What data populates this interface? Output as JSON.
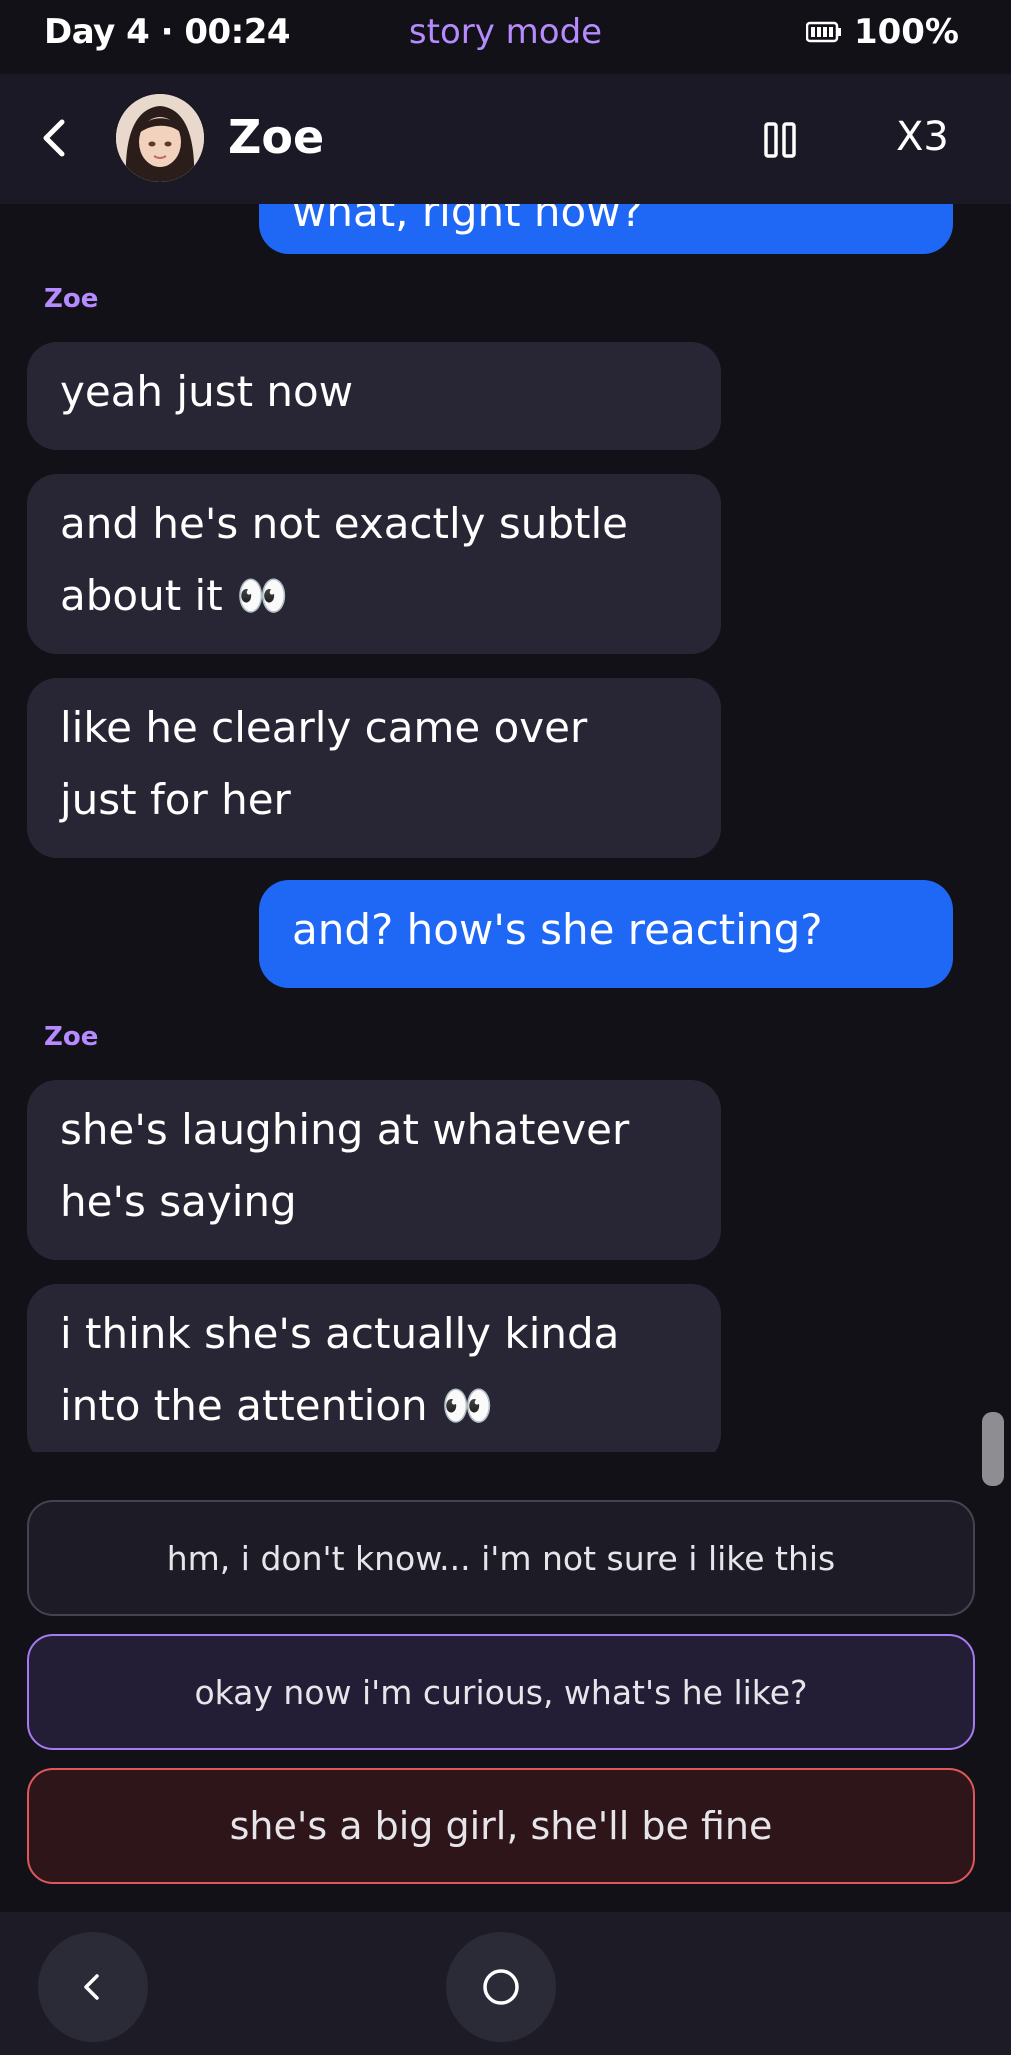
{
  "status": {
    "time_label": "Day 4 · 00:24",
    "mode": "story mode",
    "battery": "100%"
  },
  "header": {
    "contact_name": "Zoe",
    "speed": "X3"
  },
  "messages": {
    "top_partial": "what, right now?",
    "sender_1": "Zoe",
    "m1": "yeah just now",
    "m2_line1": "and he's not exactly subtle",
    "m2_line2": "about it 👀",
    "m3_line1": "like he clearly came over",
    "m3_line2": "just for her",
    "out1": "and? how's she reacting?",
    "sender_2": "Zoe",
    "m4_line1": "she's laughing at whatever",
    "m4_line2": "he's saying",
    "m5_line1": "i think she's actually kinda",
    "m5_line2": "into the attention 👀"
  },
  "choices": [
    {
      "label": "hm, i don't know... i'm not sure i like this"
    },
    {
      "label": "okay now i'm curious, what's he like?"
    },
    {
      "label": "she's a big girl, she'll be fine"
    }
  ],
  "colors": {
    "accent": "#b58bff",
    "outgoing": "#1f67f5",
    "incoming": "#282634",
    "danger": "#e0575b"
  },
  "icons": [
    "back-arrow-icon",
    "pause-icon",
    "battery-icon",
    "nav-back-icon",
    "nav-home-icon"
  ]
}
